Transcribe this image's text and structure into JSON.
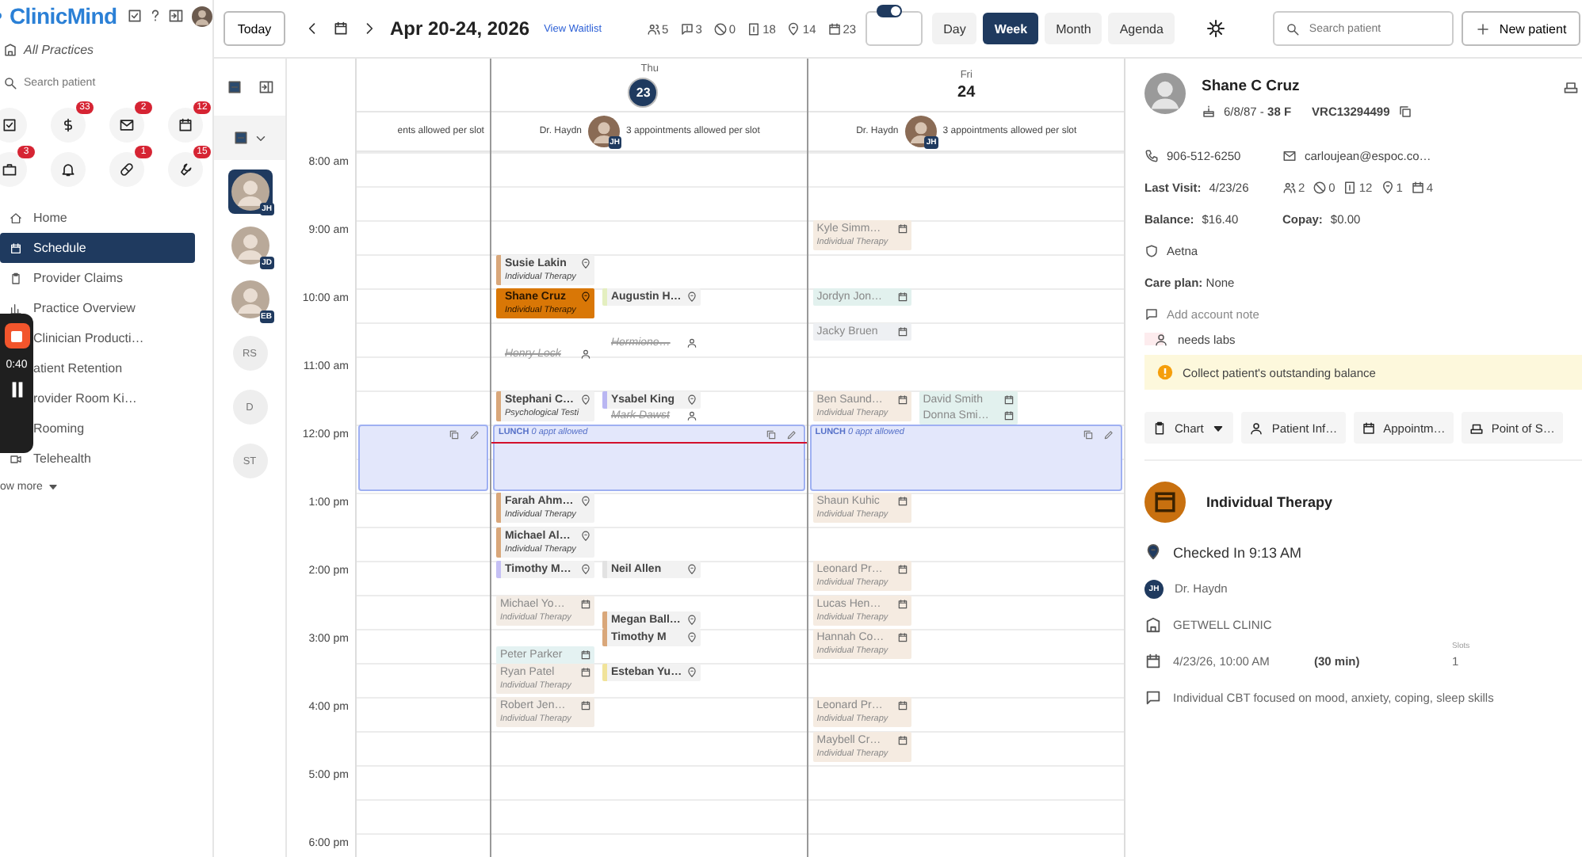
{
  "sidebar": {
    "logo": "ClinicMind",
    "practice": "All Practices",
    "search": {
      "placeholder": "Search patient"
    },
    "shortcuts": [
      {
        "badge": false
      },
      {
        "badge": true,
        "count": "33"
      },
      {
        "badge": true,
        "count": "2"
      },
      {
        "badge": true,
        "count": "12"
      },
      {
        "badge": true,
        "count": "3"
      },
      {
        "badge": false
      },
      {
        "badge": true,
        "count": "1"
      },
      {
        "badge": true,
        "count": "15"
      }
    ],
    "nav": [
      {
        "label": "Home",
        "selected": false
      },
      {
        "label": "Schedule",
        "selected": true
      },
      {
        "label": "Provider Claims",
        "selected": false
      },
      {
        "label": "Practice Overview",
        "selected": false
      },
      {
        "label": "Clinician Producti…",
        "selected": false
      },
      {
        "label": "atient Retention",
        "selected": false
      },
      {
        "label": "rovider Room Ki…",
        "selected": false
      },
      {
        "label": "Rooming",
        "selected": false
      },
      {
        "label": "Telehealth",
        "selected": false
      }
    ],
    "more": "ow more",
    "recorder": {
      "time": "0:40"
    }
  },
  "toolbar": {
    "today": "Today",
    "range": "Apr 20-24, 2026",
    "waitlist": "View Waitlist",
    "stats": [
      "5",
      "3",
      "0",
      "18",
      "14",
      "23"
    ],
    "toggle": {
      "on": true
    },
    "views": [
      {
        "label": "Day",
        "selected": false
      },
      {
        "label": "Week",
        "selected": true
      },
      {
        "label": "Month",
        "selected": false
      },
      {
        "label": "Agenda",
        "selected": false
      }
    ],
    "search": {
      "placeholder": "Search patient"
    },
    "new_patient": "New patient"
  },
  "providers": [
    {
      "kind": "photo",
      "initials": "JH",
      "selected": true
    },
    {
      "kind": "photo",
      "initials": "JD",
      "selected": false
    },
    {
      "kind": "photo",
      "initials": "EB",
      "selected": false
    },
    {
      "kind": "initials",
      "initials": "RS",
      "selected": false
    },
    {
      "kind": "initials",
      "initials": "D",
      "selected": false
    },
    {
      "kind": "initials",
      "initials": "ST",
      "selected": false
    }
  ],
  "calendar": {
    "times": [
      "8:00 am",
      "9:00 am",
      "10:00 am",
      "11:00 am",
      "12:00 pm",
      "1:00 pm",
      "2:00 pm",
      "3:00 pm",
      "4:00 pm",
      "5:00 pm",
      "6:00 pm"
    ],
    "days": [
      {
        "kind": "partial",
        "slot_note": "ents allowed per slot",
        "lunch": {
          "kind": "block"
        }
      },
      {
        "kind": "full",
        "weekday": "Thu",
        "date": "23",
        "today": true,
        "provider": "Dr. Haydn",
        "initials": "JH",
        "slot_note": "3 appointments allowed per slot",
        "lunch": {
          "kind": "block",
          "title": "LUNCH",
          "note": "0 appt allowed"
        },
        "appointments": [
          {
            "name": "Susie Lakin",
            "detail": "Individual Therapy",
            "kind": "arrived",
            "color": "#d9a77a",
            "selected": false
          },
          {
            "name": "Shane Cruz",
            "detail": "Individual Therapy",
            "kind": "arrived",
            "color": "#d97706",
            "selected": true
          },
          {
            "name": "Augustin H…",
            "kind": "arrived",
            "color": "#e4efc0",
            "selected": false
          },
          {
            "name": "Hermione…",
            "kind": "cancelled",
            "selected": false
          },
          {
            "name": "Henry Lock",
            "kind": "cancelled",
            "selected": false
          },
          {
            "name": "Stephani C…",
            "detail": "Psychological Testi",
            "kind": "arrived",
            "color": "#d9a77a",
            "selected": false
          },
          {
            "name": "Ysabel King",
            "kind": "arrived",
            "color": "#b9b6f2",
            "selected": false
          },
          {
            "name": "Mark Dawst",
            "kind": "cancelled",
            "selected": false
          },
          {
            "name": "Farah Ahm…",
            "detail": "Individual Therapy",
            "kind": "arrived",
            "color": "#d9a77a",
            "selected": false
          },
          {
            "name": "Michael Al…",
            "detail": "Individual Therapy",
            "kind": "arrived",
            "color": "#d9a77a",
            "selected": false
          },
          {
            "name": "Timothy M…",
            "kind": "arrived",
            "color": "#c5c0f5",
            "selected": false
          },
          {
            "name": "Neil Allen",
            "kind": "arrived",
            "color": "#e2e2e2",
            "selected": false
          },
          {
            "name": "Michael Yo…",
            "detail": "Individual Therapy",
            "kind": "scheduled",
            "color": "#f3ece5",
            "selected": false
          },
          {
            "name": "Megan Ball…",
            "kind": "arrived",
            "color": "#d9a77a",
            "selected": false
          },
          {
            "name": "Timothy M",
            "kind": "arrived",
            "color": "#d9a77a",
            "selected": false
          },
          {
            "name": "Peter Parker",
            "kind": "scheduled",
            "color": "#e4f2f2",
            "selected": false
          },
          {
            "name": "Ryan Patel",
            "detail": "Individual Therapy",
            "kind": "scheduled",
            "color": "#f3ece5",
            "selected": false
          },
          {
            "name": "Esteban Yu…",
            "kind": "arrived",
            "color": "#f1e39a",
            "selected": false
          },
          {
            "name": "Robert Jen…",
            "detail": "Individual Therapy",
            "kind": "scheduled",
            "color": "#f3ece5",
            "selected": false
          }
        ]
      },
      {
        "kind": "full",
        "weekday": "Fri",
        "date": "24",
        "today": false,
        "provider": "Dr. Haydn",
        "initials": "JH",
        "slot_note": "3 appointments allowed per slot",
        "lunch": {
          "kind": "block",
          "title": "LUNCH",
          "note": "0 appt allowed"
        },
        "appointments": [
          {
            "name": "Kyle Simm…",
            "detail": "Individual Therapy",
            "kind": "scheduled",
            "color": "#f5ebe1",
            "selected": false
          },
          {
            "name": "Jordyn Jon…",
            "kind": "scheduled",
            "color": "#e2f1ee",
            "selected": false
          },
          {
            "name": "Jacky Bruen",
            "kind": "scheduled",
            "color": "#eef0f3",
            "selected": false
          },
          {
            "name": "Ben Saund…",
            "detail": "Individual Therapy",
            "kind": "scheduled",
            "color": "#f5ebe1",
            "selected": false
          },
          {
            "name": "David Smith",
            "kind": "scheduled",
            "color": "#e2f1ee",
            "selected": false
          },
          {
            "name": "Donna Smi…",
            "kind": "scheduled",
            "color": "#e2f1ee",
            "selected": false
          },
          {
            "name": "Shaun Kuhic",
            "detail": "Individual Therapy",
            "kind": "scheduled",
            "color": "#f5ebe1",
            "selected": false
          },
          {
            "name": "Leonard Pr…",
            "detail": "Individual Therapy",
            "kind": "scheduled",
            "color": "#f5ebe1",
            "selected": false
          },
          {
            "name": "Lucas Hen…",
            "detail": "Individual Therapy",
            "kind": "scheduled",
            "color": "#f5ebe1",
            "selected": false
          },
          {
            "name": "Hannah Co…",
            "detail": "Individual Therapy",
            "kind": "scheduled",
            "color": "#f5ebe1",
            "selected": false
          },
          {
            "name": "Leonard Pr…",
            "detail": "Individual Therapy",
            "kind": "scheduled",
            "color": "#f5ebe1",
            "selected": false
          },
          {
            "name": "Maybell Cr…",
            "detail": "Individual Therapy",
            "kind": "scheduled",
            "color": "#f5ebe1",
            "selected": false
          }
        ]
      }
    ]
  },
  "patient": {
    "name": "Shane C Cruz",
    "dob": "6/8/87 - **38 F**",
    "mrn": "VRC13294499",
    "phone": "906-512-6250",
    "email": "carloujean@espoc.co…",
    "last_visit": "**Last Visit:** 4/23/26",
    "stats": [
      "2",
      "0",
      "12",
      "1",
      "4"
    ],
    "balance": "**Balance:** $16.40",
    "copay": "**Copay:** $0.00",
    "insurance": "Aetna",
    "care_plan": "**Care plan:** None",
    "add_note": "Add account note",
    "alerts": [
      {
        "kind": "flag",
        "text": "needs labs"
      },
      {
        "kind": "warning",
        "text": "Collect patient's outstanding balance"
      }
    ],
    "actions": [
      {
        "label": "Chart",
        "dropdown": true
      },
      {
        "label": "Patient Inf…",
        "dropdown": false
      },
      {
        "label": "Appointm…",
        "dropdown": false
      },
      {
        "label": "Point of S…",
        "dropdown": false
      }
    ],
    "appointment": {
      "title": "Individual Therapy",
      "checked_in": "Checked In 9:13 AM",
      "provider_initials": "JH",
      "provider": "Dr. Haydn",
      "location": "GETWELL CLINIC",
      "datetime": "4/23/26, 10:00 AM",
      "duration": "(30 min)",
      "slots_label": "Slots",
      "slots": "1",
      "note": "Individual CBT focused on mood, anxiety, coping, sleep skills"
    }
  }
}
